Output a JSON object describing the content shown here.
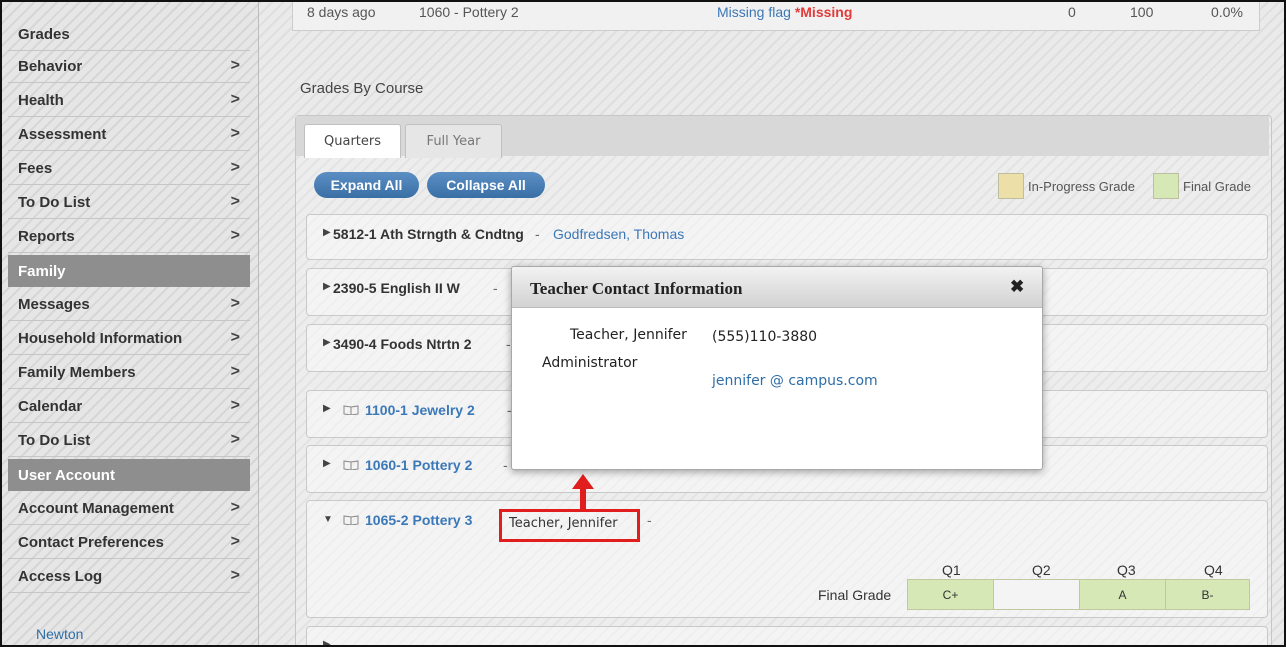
{
  "sidebar": {
    "items": [
      {
        "label": "Grades",
        "chevron": false,
        "header": false
      },
      {
        "label": "Behavior",
        "chevron": true,
        "header": false
      },
      {
        "label": "Health",
        "chevron": true,
        "header": false
      },
      {
        "label": "Assessment",
        "chevron": true,
        "header": false
      },
      {
        "label": "Fees",
        "chevron": true,
        "header": false
      },
      {
        "label": "To Do List",
        "chevron": true,
        "header": false
      },
      {
        "label": "Reports",
        "chevron": true,
        "header": false
      },
      {
        "label": "Family",
        "chevron": false,
        "header": true
      },
      {
        "label": "Messages",
        "chevron": true,
        "header": false
      },
      {
        "label": "Household Information",
        "chevron": true,
        "header": false
      },
      {
        "label": "Family Members",
        "chevron": true,
        "header": false
      },
      {
        "label": "Calendar",
        "chevron": true,
        "header": false
      },
      {
        "label": "To Do List",
        "chevron": true,
        "header": false
      },
      {
        "label": "User Account",
        "chevron": false,
        "header": true
      },
      {
        "label": "Account Management",
        "chevron": true,
        "header": false
      },
      {
        "label": "Contact Preferences",
        "chevron": true,
        "header": false
      },
      {
        "label": "Access Log",
        "chevron": true,
        "header": false
      }
    ],
    "chevron_glyph": ">",
    "footer_link": "Newton"
  },
  "top_row": {
    "when": "8 days ago",
    "course": "1060 - Pottery 2",
    "flag": "Missing flag",
    "flag_marker": "*Missing",
    "score": "0",
    "total": "100",
    "percent": "0.0%"
  },
  "grades": {
    "section_title": "Grades By Course",
    "tabs": [
      "Quarters",
      "Full Year"
    ],
    "expand_all": "Expand All",
    "collapse_all": "Collapse All",
    "legend": {
      "in_progress": "In-Progress Grade",
      "final": "Final Grade",
      "in_progress_color": "#ecdfa7",
      "final_color": "#d6e8b6"
    },
    "courses": [
      {
        "name": "5812-1 Ath Strngth & Cndtng",
        "dash": "-",
        "teacher": "Godfredsen, Thomas",
        "link": false,
        "icon": false
      },
      {
        "name": "2390-5 English II W",
        "dash": "-",
        "teacher": "",
        "link": false,
        "icon": false
      },
      {
        "name": "3490-4 Foods Ntrtn 2",
        "dash": "-",
        "teacher": "",
        "link": false,
        "icon": false
      },
      {
        "name": "1100-1 Jewelry 2",
        "dash": "-",
        "teacher": "",
        "link": true,
        "icon": true
      },
      {
        "name": "1060-1 Pottery 2",
        "dash": "-",
        "teacher": "",
        "link": true,
        "icon": true
      },
      {
        "name": "1065-2 Pottery 3",
        "dash": "-",
        "teacher": "Teacher, Jennifer",
        "link": true,
        "icon": true
      }
    ],
    "expanded_course": {
      "quarters": [
        "Q1",
        "Q2",
        "Q3",
        "Q4"
      ],
      "row_label": "Final Grade",
      "grades": [
        "C+",
        "",
        "A",
        "B-"
      ]
    }
  },
  "popup": {
    "title": "Teacher Contact Information",
    "close_glyph": "✖",
    "teacher_name": "Teacher, Jennifer",
    "role": "Administrator",
    "phone": "(555)110-3880",
    "email": "jennifer @ campus.com"
  },
  "colors": {
    "accent": "#3a78b8",
    "annotation": "#e01e1e",
    "sidebar_header": "#8e8e8e"
  }
}
